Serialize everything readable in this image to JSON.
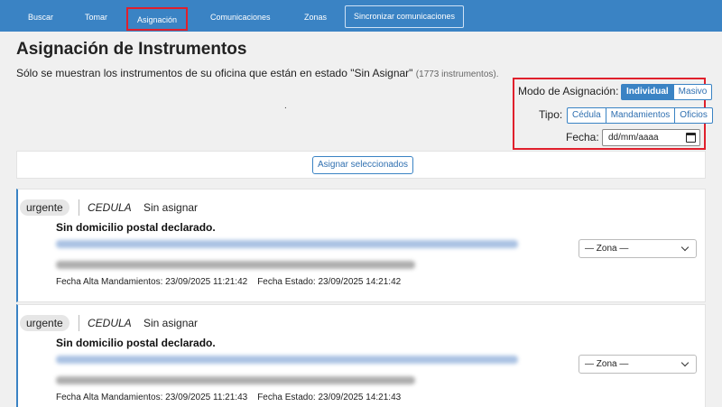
{
  "nav": {
    "items": [
      {
        "label": "Buscar"
      },
      {
        "label": "Tomar"
      },
      {
        "label": "Asignación"
      },
      {
        "label": "Comunicaciones"
      },
      {
        "label": "Zonas"
      },
      {
        "label": "Sincronizar comunicaciones"
      }
    ],
    "active_index": 2
  },
  "page": {
    "title": "Asignación de Instrumentos",
    "subtitle": "Sólo se muestran los instrumentos de su oficina que están en estado \"Sin Asignar\"",
    "count": "(1773 instrumentos).",
    "dot": "."
  },
  "assign_panel": {
    "mode_label": "Modo de Asignación:",
    "mode_options": [
      "Individual",
      "Masivo"
    ],
    "mode_selected": "Individual",
    "type_label": "Tipo:",
    "type_options": [
      "Cédula",
      "Mandamientos",
      "Oficios"
    ],
    "date_label": "Fecha:",
    "date_placeholder": "dd/mm/aaaa"
  },
  "assign_button": "Asignar seleccionados",
  "instruments": [
    {
      "priority": "urgente",
      "type": "CEDULA",
      "state": "Sin asignar",
      "address": "Sin domicilio postal declarado.",
      "fecha_alta": "Fecha Alta Mandamientos: 23/09/2025 11:21:42",
      "fecha_estado": "Fecha Estado: 23/09/2025 14:21:42",
      "zona": "— Zona —"
    },
    {
      "priority": "urgente",
      "type": "CEDULA",
      "state": "Sin asignar",
      "address": "Sin domicilio postal declarado.",
      "fecha_alta": "Fecha Alta Mandamientos: 23/09/2025 11:21:43",
      "fecha_estado": "Fecha Estado: 23/09/2025 14:21:43",
      "zona": "— Zona —"
    }
  ],
  "colors": {
    "nav_bg": "#3a83c4",
    "highlight": "#e0202c",
    "accent": "#3a83c4"
  }
}
